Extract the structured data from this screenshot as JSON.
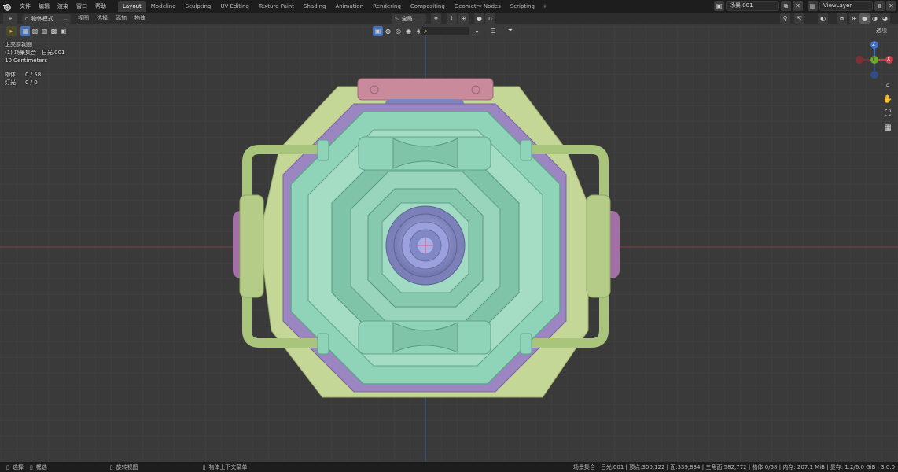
{
  "topbar": {
    "menu": [
      "文件",
      "编辑",
      "渲染",
      "窗口",
      "帮助"
    ],
    "workspaces": [
      "Layout",
      "Modeling",
      "Sculpting",
      "UV Editing",
      "Texture Paint",
      "Shading",
      "Animation",
      "Rendering",
      "Compositing",
      "Geometry Nodes",
      "Scripting"
    ],
    "active_workspace": "Layout",
    "add_tab": "+",
    "scene_name": "场景.001",
    "view_layer": "ViewLayer"
  },
  "viewport_header": {
    "mode": "物体模式",
    "menu": [
      "视图",
      "选择",
      "添加",
      "物体"
    ],
    "transform_orientation": "全局",
    "options_label": "选项"
  },
  "overlay": {
    "view_name": "正交前视图",
    "collection_line": "(1) 场景集合 | 日光.001",
    "grid_scale": "10 Centimeters",
    "objects_label": "物体",
    "objects_value": "0 / 58",
    "lights_label": "灯光",
    "lights_value": "0 / 0"
  },
  "gizmo": {
    "z": "Z",
    "y": "Y",
    "x": "X"
  },
  "colors": {
    "viewport_bg": "#3a3a3a",
    "grid": "#444444",
    "axis_red": "#8a3a3f",
    "axis_blue": "#3d5e95",
    "shell_green": "#c5d796",
    "frame_purple": "#9b86c2",
    "core_teal": "#8fd3b8",
    "pink_cap": "#c98a9c",
    "blue_core": "#8990c8"
  },
  "statusbar": {
    "select": "选择",
    "box_select": "框选",
    "rotate_view": "旋转视图",
    "context_menu": "物体上下文菜单",
    "stats": "场景集合 | 日光.001 | 顶点:300,122 | 面:339,834 | 三角面:582,772 | 物体:0/58 | 内存: 207.1 MiB | 显存: 1.2/6.0 GiB | 3.0.0"
  }
}
